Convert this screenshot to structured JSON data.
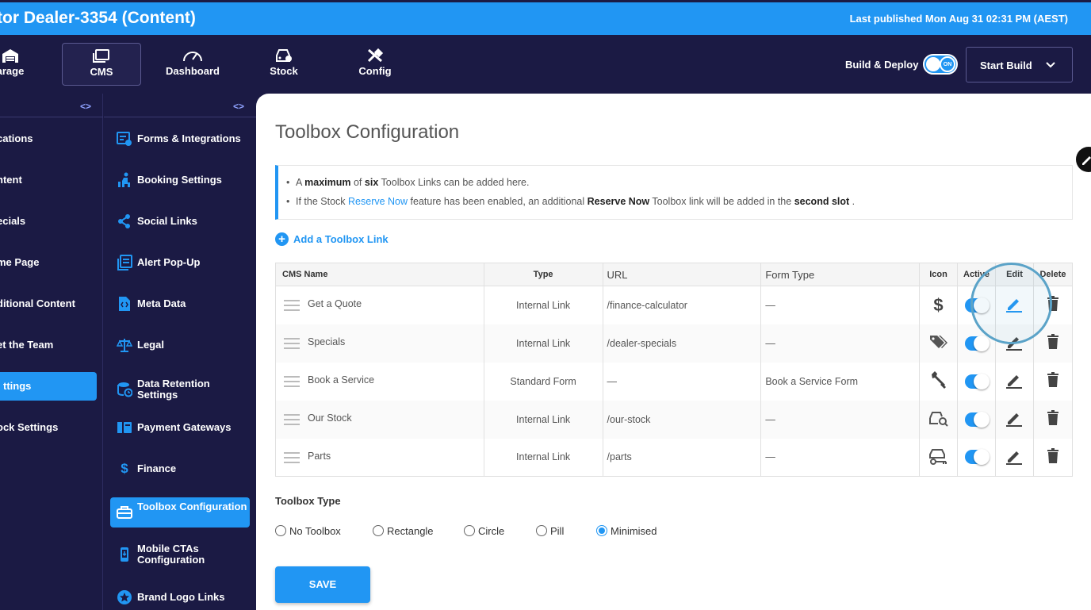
{
  "header": {
    "title": "tor Dealer-3354 (Content)",
    "last_published": "Last published Mon Aug 31 02:31 PM (AEST)"
  },
  "nav": {
    "items": [
      {
        "label": "arage",
        "icon": "garage-icon"
      },
      {
        "label": "CMS",
        "icon": "cms-icon",
        "active": true
      },
      {
        "label": "Dashboard",
        "icon": "dashboard-icon"
      },
      {
        "label": "Stock",
        "icon": "stock-icon"
      },
      {
        "label": "Config",
        "icon": "config-icon"
      }
    ],
    "build_deploy_label": "Build & Deploy",
    "build_toggle_text": "ON",
    "start_build_label": "Start Build"
  },
  "sidebar1": {
    "collapse_icon": "<>",
    "items": [
      {
        "label": "cations"
      },
      {
        "label": "ntent"
      },
      {
        "label": "ecials"
      },
      {
        "label": "me Page"
      },
      {
        "label": "ditional Content"
      },
      {
        "label": "et the Team"
      },
      {
        "label": "ttings",
        "active": true
      },
      {
        "label": "ock Settings"
      }
    ]
  },
  "sidebar2": {
    "collapse_icon": "<>",
    "items": [
      {
        "label": "Forms & Integrations",
        "icon": "form-settings-icon"
      },
      {
        "label": "Booking Settings",
        "icon": "booking-icon"
      },
      {
        "label": "Social Links",
        "icon": "share-icon"
      },
      {
        "label": "Alert Pop-Up",
        "icon": "alert-popup-icon"
      },
      {
        "label": "Meta Data",
        "icon": "metadata-icon"
      },
      {
        "label": "Legal",
        "icon": "scales-icon"
      },
      {
        "label": "Data Retention Settings",
        "icon": "data-retention-icon"
      },
      {
        "label": "Payment Gateways",
        "icon": "payment-icon"
      },
      {
        "label": "Finance",
        "icon": "dollar-icon"
      },
      {
        "label": "Toolbox Configuration",
        "icon": "toolbox-icon",
        "active": true
      },
      {
        "label": "Mobile CTAs Configuration",
        "icon": "mobile-icon"
      },
      {
        "label": "Brand Logo Links",
        "icon": "brand-logo-icon"
      }
    ]
  },
  "page": {
    "title": "Toolbox Configuration",
    "info": {
      "line1": {
        "a": "A",
        "b1": "maximum",
        "c": "of",
        "b2": "six",
        "d": "Toolbox Links can be added here."
      },
      "line2": {
        "a": "If the Stock",
        "link": "Reserve Now",
        "b": "feature has been enabled, an additional",
        "bold1": "Reserve Now",
        "c": "Toolbox link will be added in the",
        "bold2": "second slot",
        "d": "."
      }
    },
    "add_link_label": "Add a Toolbox Link",
    "add_link_icon": "+"
  },
  "table": {
    "headers": [
      "CMS Name",
      "Type",
      "URL",
      "Form Type",
      "Icon",
      "Active",
      "Edit",
      "Delete"
    ],
    "rows": [
      {
        "name": "Get a Quote",
        "type": "Internal Link",
        "url": "/finance-calculator",
        "form_type": "—",
        "icon": "dollar-icon",
        "active": true
      },
      {
        "name": "Specials",
        "type": "Internal Link",
        "url": "/dealer-specials",
        "form_type": "—",
        "icon": "tags-icon",
        "active": true
      },
      {
        "name": "Book a Service",
        "type": "Standard Form",
        "url": "—",
        "form_type": "Book a Service Form",
        "icon": "wrench-icon",
        "active": true
      },
      {
        "name": "Our Stock",
        "type": "Internal Link",
        "url": "/our-stock",
        "form_type": "—",
        "icon": "car-search-icon",
        "active": true
      },
      {
        "name": "Parts",
        "type": "Internal Link",
        "url": "/parts",
        "form_type": "—",
        "icon": "car-key-icon",
        "active": true
      }
    ]
  },
  "toolbox_type": {
    "label": "Toolbox Type",
    "options": [
      "No Toolbox",
      "Rectangle",
      "Circle",
      "Pill",
      "Minimised"
    ],
    "selected": "Minimised"
  },
  "save_label": "SAVE",
  "colors": {
    "accent": "#2196f3",
    "nav_bg": "#1b1a44",
    "highlight": "#5ba3c8"
  }
}
